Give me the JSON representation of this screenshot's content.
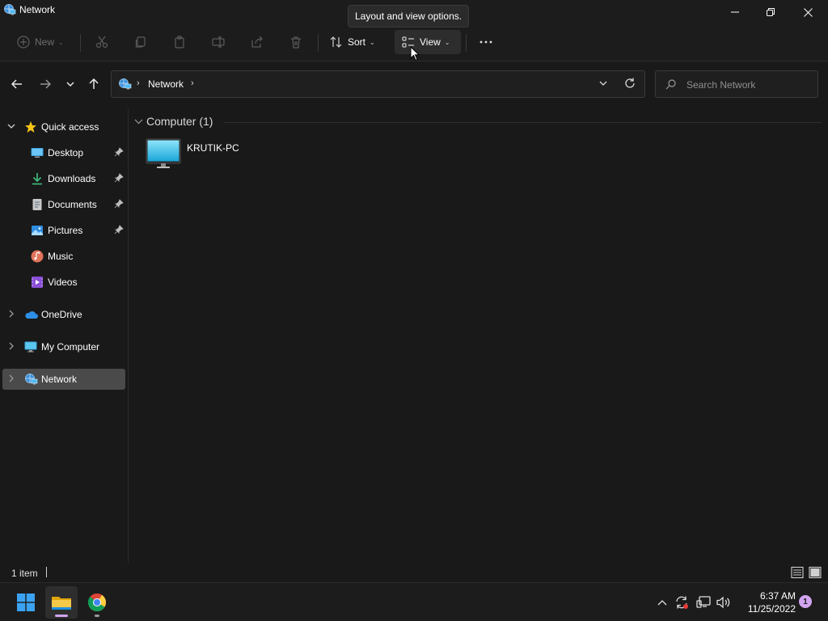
{
  "window": {
    "title": "Network",
    "controls": {
      "minimize": "minimize-icon",
      "maximize": "restore-icon",
      "close": "close-icon"
    }
  },
  "tooltip": "Layout and view options.",
  "toolbar": {
    "new_label": "New",
    "sort_label": "Sort",
    "view_label": "View",
    "disabled_actions": [
      "cut-icon",
      "copy-icon",
      "paste-icon",
      "rename-icon",
      "share-icon",
      "delete-icon"
    ],
    "more_icon": "more-options-icon"
  },
  "address": {
    "crumbs": [
      "Network"
    ],
    "search_placeholder": "Search Network"
  },
  "sidebar": {
    "items": [
      {
        "label": "Quick access",
        "icon": "star-icon",
        "expanded": true
      },
      {
        "label": "Desktop",
        "icon": "desktop-icon",
        "pinned": true
      },
      {
        "label": "Downloads",
        "icon": "downloads-icon",
        "pinned": true
      },
      {
        "label": "Documents",
        "icon": "documents-icon",
        "pinned": true
      },
      {
        "label": "Pictures",
        "icon": "pictures-icon",
        "pinned": true
      },
      {
        "label": "Music",
        "icon": "music-icon",
        "pinned": false
      },
      {
        "label": "Videos",
        "icon": "videos-icon",
        "pinned": false
      },
      {
        "label": "OneDrive",
        "icon": "onedrive-icon",
        "expanded": false
      },
      {
        "label": "My Computer",
        "icon": "computer-icon",
        "expanded": false
      },
      {
        "label": "Network",
        "icon": "network-icon",
        "expanded": false,
        "selected": true
      }
    ]
  },
  "content": {
    "group_title": "Computer (1)",
    "items": [
      {
        "name": "KRUTIK-PC",
        "icon": "computer-monitor-icon"
      }
    ]
  },
  "status": {
    "item_count": "1 item"
  },
  "taskbar": {
    "apps": [
      "start-icon",
      "file-explorer-icon",
      "chrome-icon"
    ],
    "time": "6:37 AM",
    "date": "11/25/2022",
    "notification_count": "1"
  },
  "colors": {
    "background": "#191919",
    "selection": "#4a4a4a",
    "accent": "#60cdff"
  }
}
